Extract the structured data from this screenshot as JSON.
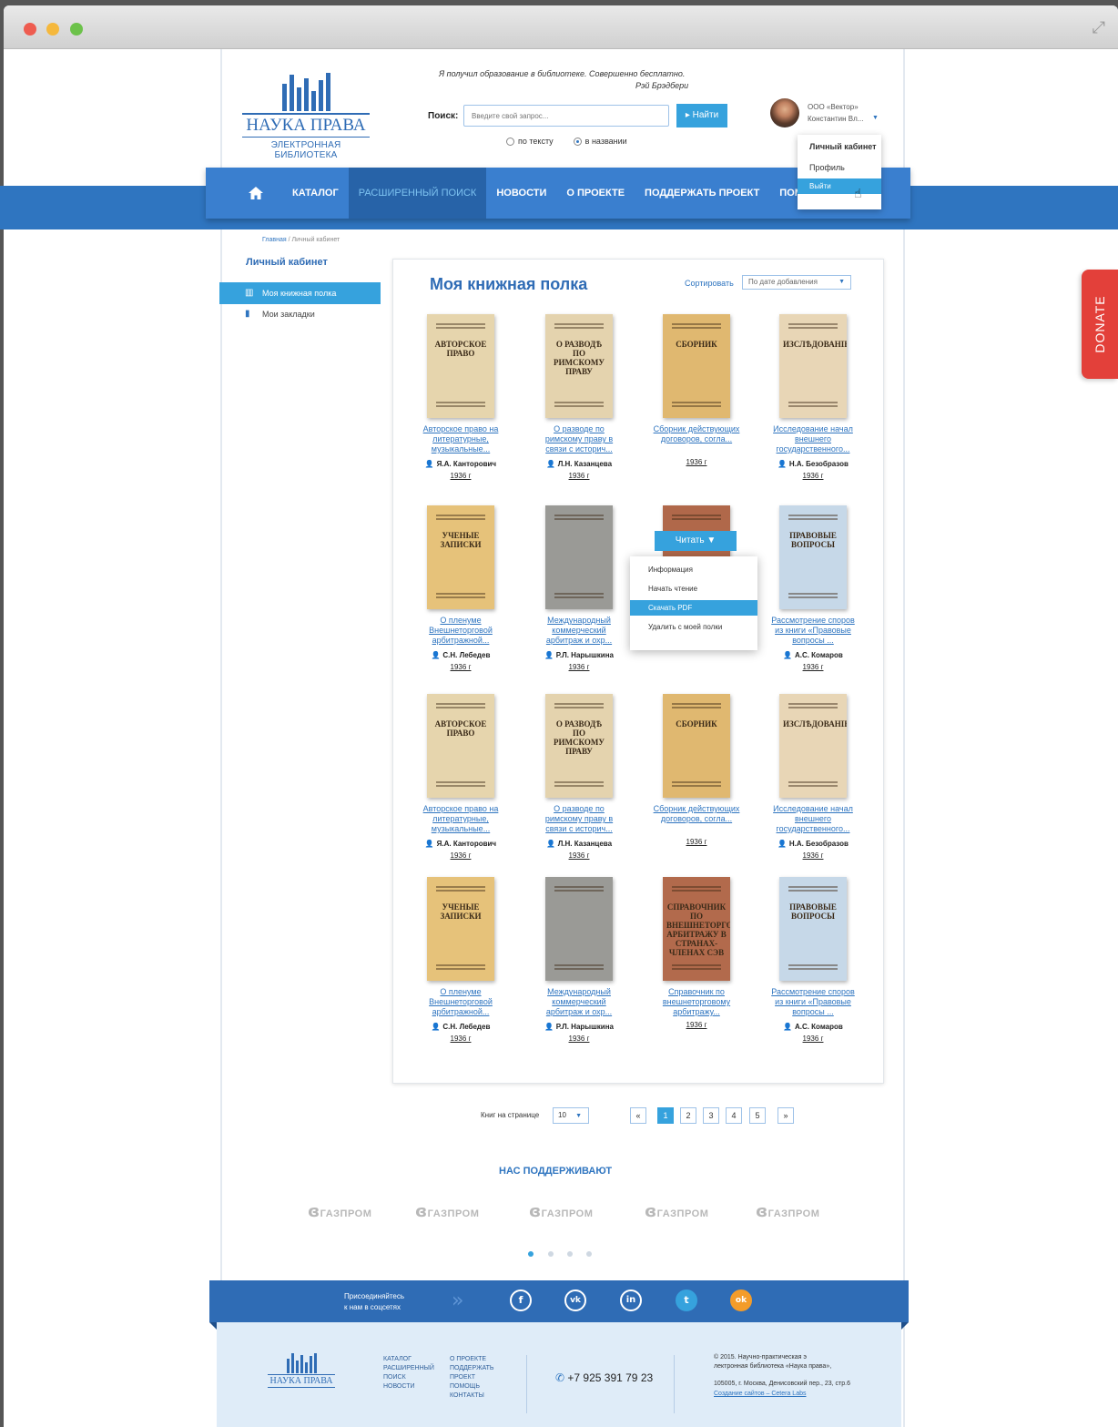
{
  "header": {
    "logo_title": "НАУКА ПРАВА",
    "logo_subtitle": "ЭЛЕКТРОННАЯ БИБЛИОТЕКА",
    "quote": "Я получил образование в библиотеке. Совершенно бесплатно.",
    "quote_author": "Рэй Брэдбери",
    "search_label": "Поиск:",
    "search_placeholder": "Введите свой запрос...",
    "search_button": "Найти",
    "radio_text": "по тексту",
    "radio_title": "в названии",
    "user_org": "ООО «Вектор»",
    "user_name": "Константин Вл...",
    "user_menu": {
      "title": "Личный кабинет",
      "profile": "Профиль",
      "logout": "Выйти"
    }
  },
  "nav": {
    "items": [
      "КАТАЛОГ",
      "РАСШИРЕННЫЙ ПОИСК",
      "НОВОСТИ",
      "О ПРОЕКТЕ",
      "ПОДДЕРЖАТЬ ПРОЕКТ",
      "ПОМО"
    ]
  },
  "breadcrumb": {
    "home": "Главная",
    "sep": "/",
    "current": "Личный кабинет"
  },
  "sidebar": {
    "title": "Личный кабинет",
    "items": [
      {
        "label": "Моя книжная полка"
      },
      {
        "label": "Мои закладки"
      }
    ]
  },
  "shelf": {
    "title": "Моя книжная полка",
    "sort_label": "Сортировать",
    "sort_value": "По дате добавления",
    "books": [
      {
        "title": "Авторское право на литературные, музыкальные...",
        "author": "Я.А. Канторович",
        "year": "1936 г",
        "cover_text": "АВТОРСКОЕ ПРАВО",
        "cover_color": "#e6d5ad"
      },
      {
        "title": "О разводе по римскому праву в связи с историч...",
        "author": "Л.Н. Казанцева",
        "year": "1936 г",
        "cover_text": "О РАЗВОДѢ ПО РИМСКОМУ ПРАВУ",
        "cover_color": "#e4d3ae"
      },
      {
        "title": "Сборник действующих договоров, согла...",
        "author": "",
        "year": "1936 г",
        "cover_text": "СБОРНИК",
        "cover_color": "#e0b870"
      },
      {
        "title": "Исследование начал внешнего государственного...",
        "author": "Н.А. Безобразов",
        "year": "1936 г",
        "cover_text": "ИЗСЛѢДОВАНІЕ",
        "cover_color": "#e8d6b6"
      },
      {
        "title": "О пленуме Внешнеторговой арбитражной...",
        "author": "С.Н. Лебедев",
        "year": "1936 г",
        "cover_text": "УЧЕНЫЕ ЗАПИСКИ",
        "cover_color": "#e6c27a"
      },
      {
        "title": "Международный коммерческий арбитраж и охр...",
        "author": "Р.Л. Нарышкина",
        "year": "1936 г",
        "cover_text": "",
        "cover_color": "#9a9a96"
      },
      {
        "title": "",
        "author": "",
        "year": "",
        "cover_text": "",
        "cover_color": "#b0684a"
      },
      {
        "title": "Рассмотрение споров из книги «Правовые вопросы ...",
        "author": "А.С. Комаров",
        "year": "1936 г",
        "cover_text": "ПРАВОВЫЕ ВОПРОСЫ",
        "cover_color": "#c6d8e8"
      },
      {
        "title": "Авторское право на литературные, музыкальные...",
        "author": "Я.А. Канторович",
        "year": "1936 г",
        "cover_text": "АВТОРСКОЕ ПРАВО",
        "cover_color": "#e6d5ad"
      },
      {
        "title": "О разводе по римскому праву в связи с историч...",
        "author": "Л.Н. Казанцева",
        "year": "1936 г",
        "cover_text": "О РАЗВОДѢ ПО РИМСКОМУ ПРАВУ",
        "cover_color": "#e4d3ae"
      },
      {
        "title": "Сборник действующих договоров, согла...",
        "author": "",
        "year": "1936 г",
        "cover_text": "СБОРНИК",
        "cover_color": "#e0b870"
      },
      {
        "title": "Исследование начал внешнего государственного...",
        "author": "Н.А. Безобразов",
        "year": "1936 г",
        "cover_text": "ИЗСЛѢДОВАНІЕ",
        "cover_color": "#e8d6b6"
      },
      {
        "title": "О пленуме Внешнеторговой арбитражной...",
        "author": "С.Н. Лебедев",
        "year": "1936 г",
        "cover_text": "УЧЕНЫЕ ЗАПИСКИ",
        "cover_color": "#e6c27a"
      },
      {
        "title": "Международный коммерческий арбитраж и охр...",
        "author": "Р.Л. Нарышкина",
        "year": "1936 г",
        "cover_text": "",
        "cover_color": "#9a9a96"
      },
      {
        "title": "Справочник по внешнеторговому арбитражу...",
        "author": "",
        "year": "1936 г",
        "cover_text": "СПРАВОЧНИК ПО ВНЕШНЕТОРГОВОМУ АРБИТРАЖУ В СТРАНАХ-ЧЛЕНАХ СЭВ",
        "cover_color": "#b26a4c"
      },
      {
        "title": "Рассмотрение споров из книги «Правовые вопросы ...",
        "author": "А.С. Комаров",
        "year": "1936 г",
        "cover_text": "ПРАВОВЫЕ ВОПРОСЫ",
        "cover_color": "#c6d8e8"
      }
    ],
    "read_button": "Читать",
    "context_menu": [
      "Информация",
      "Начать чтение",
      "Скачать PDF",
      "Удалить с моей полки"
    ]
  },
  "pagination": {
    "per_page_label": "Книг на странице",
    "per_page_value": "10",
    "prev": "«",
    "pages": [
      "1",
      "2",
      "3",
      "4",
      "5"
    ],
    "next": "»"
  },
  "support": {
    "title": "НАС ПОДДЕРЖИВАЮТ",
    "sponsors": [
      "ГАЗПРОМ",
      "ГАЗПРОМ",
      "ГАЗПРОМ",
      "ГАЗПРОМ",
      "ГАЗПРОМ"
    ]
  },
  "social": {
    "join_line1": "Присоединяйтесь",
    "join_line2": "к нам в соцсетях",
    "networks": [
      "f",
      "vk",
      "in",
      "t",
      "ok"
    ]
  },
  "footer": {
    "logo_title": "НАУКА ПРАВА",
    "links_col1": [
      "КАТАЛОГ",
      "РАСШИРЕННЫЙ",
      "ПОИСК",
      "НОВОСТИ"
    ],
    "links_col2": [
      "О ПРОЕКТЕ",
      "ПОДДЕРЖАТЬ",
      "ПРОЕКТ",
      "ПОМОЩЬ",
      "КОНТАКТЫ"
    ],
    "phone": "+7 925 391 79 23",
    "copyright_1": "© 2015. Научно-практическая э",
    "copyright_2": "лектронная библиотека «Наука права»,",
    "address": "105005, г. Москва, Денисовский пер., 23, стр.6",
    "credit": "Создание сайтов – Cetera Labs"
  },
  "donate": "DONATE",
  "colors": {
    "primary": "#2f75c0",
    "accent": "#36a2dd",
    "donate": "#e3403a"
  },
  "icons": {
    "home": "home-icon",
    "bookshelf": "bookshelf-icon",
    "bookmark": "bookmark-icon",
    "user": "user-icon",
    "phone": "phone-icon"
  }
}
